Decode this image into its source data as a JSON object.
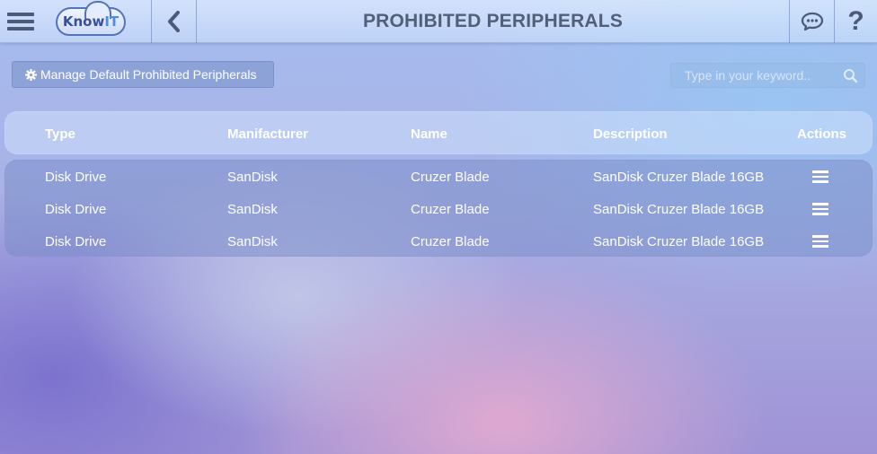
{
  "app": {
    "logo_text_a": "Know",
    "logo_text_b": "IT",
    "page_title": "PROHIBITED PERIPHERALS"
  },
  "toolbar": {
    "manage_label": "Manage Default Prohibited Peripherals",
    "search_placeholder": "Type in your keyword..",
    "search_value": ""
  },
  "table": {
    "headers": {
      "type": "Type",
      "manufacturer": "Manifacturer",
      "name": "Name",
      "description": "Description",
      "actions": "Actions"
    },
    "rows": [
      {
        "type": "Disk Drive",
        "manufacturer": "SanDisk",
        "name": "Cruzer Blade",
        "description": "SanDisk Cruzer Blade 16GB"
      },
      {
        "type": "Disk Drive",
        "manufacturer": "SanDisk",
        "name": "Cruzer Blade",
        "description": "SanDisk Cruzer Blade 16GB"
      },
      {
        "type": "Disk Drive",
        "manufacturer": "SanDisk",
        "name": "Cruzer Blade",
        "description": "SanDisk Cruzer Blade 16GB"
      }
    ]
  },
  "icons": {
    "menu": "hamburger-icon",
    "back": "chevron-left-icon",
    "chat": "chat-bubble-icon",
    "help": "question-icon",
    "gear": "gear-icon",
    "search": "search-icon",
    "row_action": "list-icon"
  },
  "colors": {
    "header_text": "#525f78",
    "icon_dark": "#4a5a78",
    "logo_blue": "#3a4f9a"
  }
}
